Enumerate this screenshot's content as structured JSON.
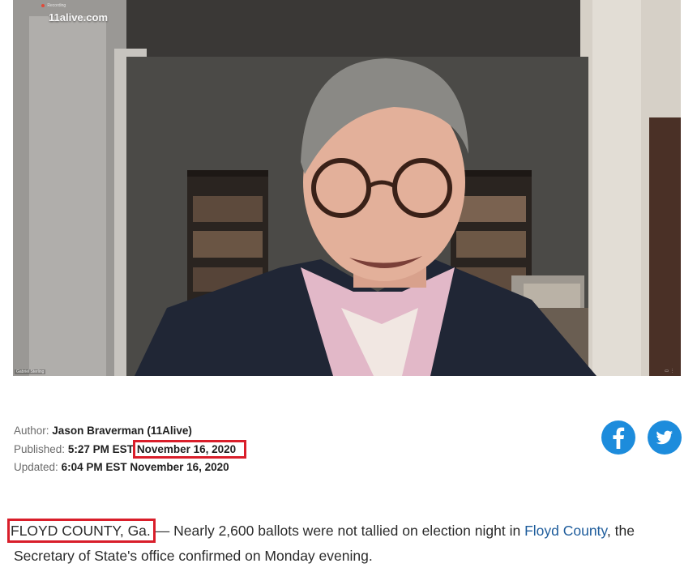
{
  "video": {
    "source_label": "11alive.com",
    "recording_label": "Recording",
    "speaker_name": "Gabriel Sterling"
  },
  "meta": {
    "author_label": "Author:",
    "author_name": "Jason Braverman (11Alive)",
    "published_label": "Published:",
    "published_time": "5:27 PM EST",
    "published_date": "November 16, 2020",
    "updated_label": "Updated:",
    "updated_time": "6:04 PM EST",
    "updated_date": "November 16, 2020"
  },
  "share": {
    "facebook_icon": "facebook-icon",
    "twitter_icon": "twitter-icon",
    "color": "#1d8cdc"
  },
  "article": {
    "dateline": "FLOYD COUNTY, Ga.",
    "text_part1": "— Nearly 2,600 ballots were not tallied on election night in",
    "link_text": "Floyd County",
    "text_part2": ", the Secretary of State's office confirmed on Monday evening."
  },
  "colors": {
    "highlight_border": "#d91e2a",
    "link": "#1f5d9c"
  }
}
